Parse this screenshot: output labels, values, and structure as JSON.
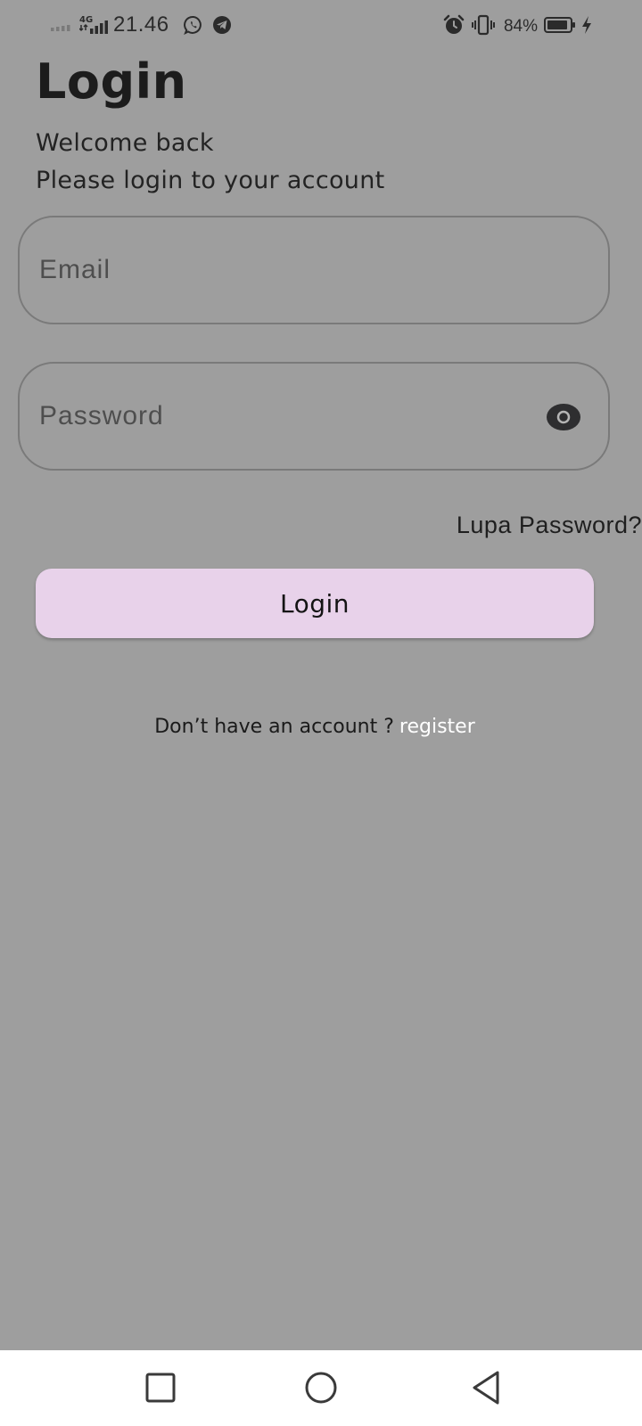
{
  "status_bar": {
    "time": "21.46",
    "network": "4G",
    "battery": "84%"
  },
  "header": {
    "title": "Login",
    "subtitle_line1": "Welcome back",
    "subtitle_line2": "Please login to your account"
  },
  "form": {
    "email": {
      "placeholder": "Email",
      "value": ""
    },
    "password": {
      "placeholder": "Password",
      "value": ""
    },
    "forgot_label": "Lupa Password?",
    "login_label": "Login"
  },
  "register": {
    "prompt": "Don’t have an account ?",
    "link_label": "register"
  },
  "icons": {
    "status": [
      "signal-icon",
      "network-4g-icon",
      "whatsapp-icon",
      "telegram-icon",
      "alarm-icon",
      "vibrate-icon",
      "battery-icon",
      "charging-icon"
    ],
    "form": [
      "eye-icon"
    ],
    "nav": [
      "recents-icon",
      "home-icon",
      "back-icon"
    ]
  },
  "colors": {
    "background": "#9e9e9e",
    "button": "#e8d2ea",
    "register_link": "#ffffff",
    "nav_bar": "#ffffff"
  }
}
